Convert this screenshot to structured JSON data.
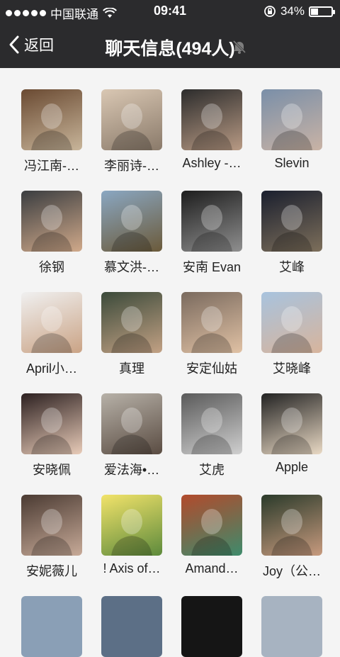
{
  "status_bar": {
    "carrier": "中国联通",
    "time": "09:41",
    "battery": "34%",
    "battery_level": 0.34
  },
  "nav": {
    "back_label": "返回",
    "title": "聊天信息(494人)"
  },
  "members": [
    {
      "name": "冯江南-…",
      "colors": [
        "#6a4a32",
        "#c8b59a"
      ]
    },
    {
      "name": "李丽诗-…",
      "colors": [
        "#d9c7b3",
        "#8a7a6a"
      ]
    },
    {
      "name": "Ashley -…",
      "colors": [
        "#2c2c2c",
        "#b89a84"
      ]
    },
    {
      "name": "Slevin",
      "colors": [
        "#7a8fa8",
        "#c9b3a5"
      ]
    },
    {
      "name": "徐钢",
      "colors": [
        "#3a3d40",
        "#d0a98a"
      ]
    },
    {
      "name": "慕文洪-…",
      "colors": [
        "#8aa7c2",
        "#6b5a3a"
      ]
    },
    {
      "name": "安南 Evan",
      "colors": [
        "#1d1d1d",
        "#8f8f8f"
      ]
    },
    {
      "name": "艾峰",
      "colors": [
        "#1a1f2e",
        "#7d6f5b"
      ]
    },
    {
      "name": "April小…",
      "colors": [
        "#f0f0f0",
        "#caa385"
      ]
    },
    {
      "name": "真理",
      "colors": [
        "#3b4a3a",
        "#c2a184"
      ]
    },
    {
      "name": "安定仙姑",
      "colors": [
        "#7a6a5e",
        "#e0c1a4"
      ]
    },
    {
      "name": "艾晓峰",
      "colors": [
        "#a8c3de",
        "#d7b49c"
      ]
    },
    {
      "name": "安晓佩",
      "colors": [
        "#2c2020",
        "#e8cbb8"
      ]
    },
    {
      "name": "爱法海•…",
      "colors": [
        "#b7b1a8",
        "#5a4c42"
      ]
    },
    {
      "name": "艾虎",
      "colors": [
        "#5a5a5a",
        "#cfcfcf"
      ]
    },
    {
      "name": "Apple",
      "colors": [
        "#222222",
        "#e9d9c4"
      ]
    },
    {
      "name": "安妮薇儿",
      "colors": [
        "#4a3a32",
        "#c7aa98"
      ]
    },
    {
      "name": "! Axis of…",
      "colors": [
        "#f2e36a",
        "#5d8a3c"
      ]
    },
    {
      "name": "Amand…",
      "colors": [
        "#b24a2c",
        "#3e8b6c"
      ]
    },
    {
      "name": "Joy（公…",
      "colors": [
        "#2a3a2a",
        "#c79a7e"
      ]
    }
  ],
  "next_row_colors": [
    "#8a9fb6",
    "#5c6f86",
    "#151515",
    "#a7b3c1"
  ]
}
